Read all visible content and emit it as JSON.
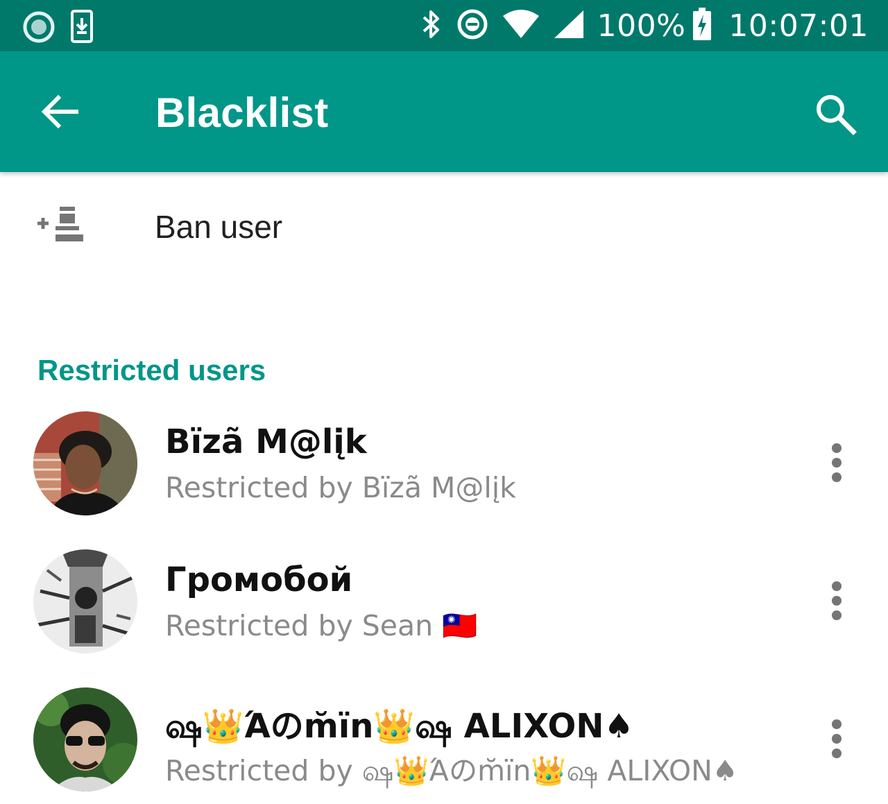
{
  "status_bar": {
    "battery": "100%",
    "time": "10:07:01",
    "left_icons": [
      "record-icon",
      "download-phone-icon"
    ],
    "right_icons": [
      "bluetooth-icon",
      "do-not-disturb-icon",
      "wifi-icon",
      "cell-signal-icon",
      "battery-charging-icon"
    ]
  },
  "app_bar": {
    "title": "Blacklist",
    "back_icon": "arrow-back-icon",
    "search_icon": "search-icon",
    "color": "#009688"
  },
  "ban_user": {
    "label": "Ban user",
    "icon": "add-ban-user-icon"
  },
  "section": {
    "title": "Restricted users",
    "color": "#009688"
  },
  "users": [
    {
      "name": "Bïzã M@lįk",
      "subtitle": "Restricted by Bïzã M@lįk"
    },
    {
      "name": "Громобой",
      "subtitle": "Restricted by Sean 🇹🇼"
    },
    {
      "name": "ஷ👑Άのm̆ïn👑ஷ ALIXON♠",
      "subtitle": "Restricted by ஷ👑Άのm̆ïn👑ஷ ALIXON♠"
    }
  ],
  "colors": {
    "status_bar": "#00796b",
    "primary": "#009688",
    "text_primary": "#111111",
    "text_secondary": "#8a8a8a"
  }
}
